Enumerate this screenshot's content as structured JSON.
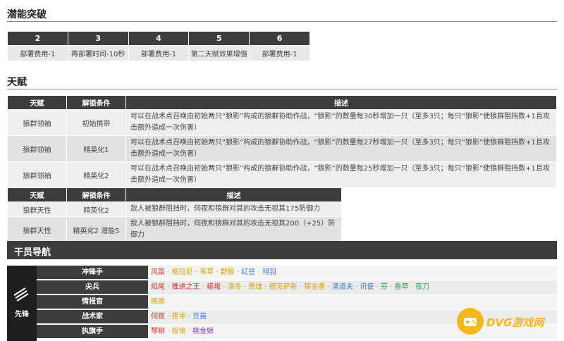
{
  "potential": {
    "title": "潜能突破",
    "headers": [
      "2",
      "3",
      "4",
      "5",
      "6"
    ],
    "values": [
      "部署费用-1",
      "再部署时间-10秒",
      "部署费用-1",
      "第二天赋效果增强",
      "部署费用-1"
    ]
  },
  "talents": {
    "title": "天赋",
    "table1": {
      "headers": [
        "天赋",
        "解锁条件",
        "描述"
      ],
      "rows": [
        {
          "name": "狼群领袖",
          "cond": "初始携带",
          "desc": "可以在战术点召唤由初始两只“狼影”构成的狼群协助作战，“狼影”的数量每30秒增加一只（至多3只；每只“狼影”使狼群阻挡数+1且攻击额外造成一次伤害）"
        },
        {
          "name": "狼群领袖",
          "cond": "精英化1",
          "desc": "可以在战术点召唤由初始两只“狼影”构成的狼群协助作战，“狼影”的数量每27秒增加一只（至多3只；每只“狼影”使狼群阻挡数+1且攻击额外造成一次伤害）"
        },
        {
          "name": "狼群领袖",
          "cond": "精英化2",
          "desc": "可以在战术点召唤由初始两只“狼影”构成的狼群协助作战，“狼影”的数量每25秒增加一只（至多3只；每只“狼影”使狼群阻挡数+1且攻击额外造成一次伤害）"
        }
      ]
    },
    "table2": {
      "headers": [
        "天赋",
        "解锁条件",
        "描述"
      ],
      "rows": [
        {
          "name": "狼群天性",
          "cond": "精英化2",
          "desc": "敌人被狼群阻挡时，伺夜和狼群对其的攻击无视其175防御力"
        },
        {
          "name": "狼群天性",
          "cond": "精英化2 潜能5",
          "desc": "敌人被狼群阻挡时，伺夜和狼群对其的攻击无视其200（+25）防御力"
        }
      ]
    }
  },
  "nav": {
    "title": "干员导航",
    "side_label": "先锋",
    "rows": [
      {
        "category": "冲锋手",
        "ops": [
          {
            "name": "风笛",
            "color": "#c0392b"
          },
          {
            "name": "格拉尼",
            "color": "#d4a017"
          },
          {
            "name": "苇草",
            "color": "#d4a017"
          },
          {
            "name": "野鬃",
            "color": "#d4a017"
          },
          {
            "name": "红豆",
            "color": "#3f78c9"
          },
          {
            "name": "翎羽",
            "color": "#3f78c9"
          }
        ]
      },
      {
        "category": "尖兵",
        "ops": [
          {
            "name": "焰尾",
            "color": "#c0392b"
          },
          {
            "name": "推进之王",
            "color": "#c0392b"
          },
          {
            "name": "嵯峨",
            "color": "#c0392b"
          },
          {
            "name": "凛冬",
            "color": "#d4a017"
          },
          {
            "name": "贾维",
            "color": "#d4a017"
          },
          {
            "name": "德克萨斯",
            "color": "#d4a017"
          },
          {
            "name": "郁金香",
            "color": "#d4a017"
          },
          {
            "name": "清道夫",
            "color": "#3f78c9"
          },
          {
            "name": "讯使",
            "color": "#3f78c9"
          },
          {
            "name": "芬",
            "color": "#2e9e4f"
          },
          {
            "name": "香草",
            "color": "#2e9e4f"
          },
          {
            "name": "夜刀",
            "color": "#2e9e4f"
          }
        ]
      },
      {
        "category": "情报官",
        "ops": [
          {
            "name": "晓歌",
            "color": "#d4a017"
          }
        ]
      },
      {
        "category": "战术家",
        "ops": [
          {
            "name": "伺夜",
            "color": "#c0392b"
          },
          {
            "name": "夜半",
            "color": "#d4a017"
          },
          {
            "name": "豆苗",
            "color": "#3f78c9"
          }
        ]
      },
      {
        "category": "执旗手",
        "ops": [
          {
            "name": "琴柳",
            "color": "#c0392b"
          },
          {
            "name": "极境",
            "color": "#d4a017"
          },
          {
            "name": "桃金娘",
            "color": "#8e44ad"
          }
        ]
      }
    ]
  },
  "watermark": {
    "text": "DVG游戏网",
    "color": "#f2b820"
  }
}
